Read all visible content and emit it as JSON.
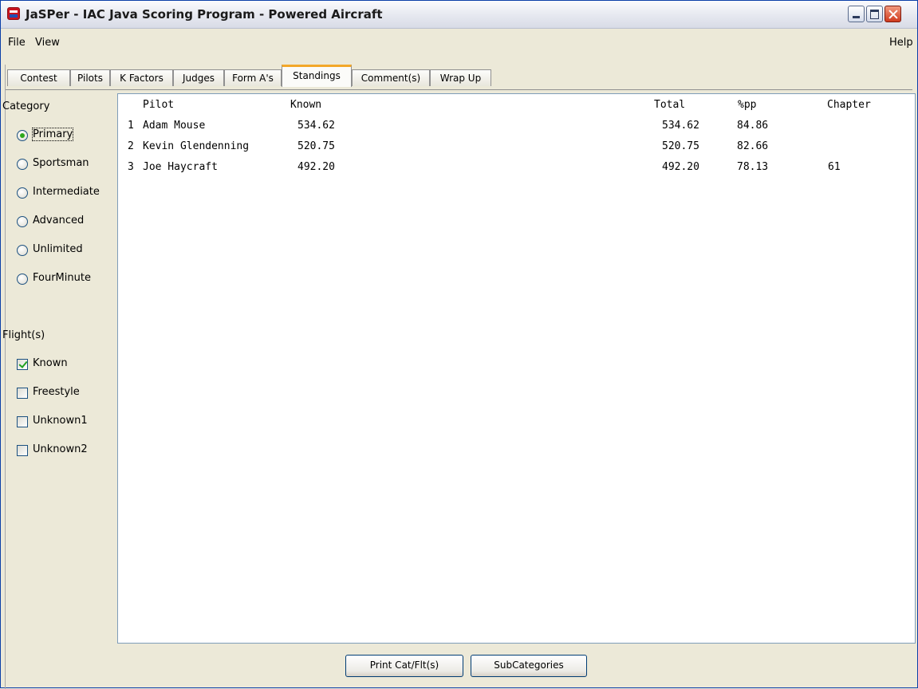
{
  "window": {
    "title": "JaSPer - IAC Java Scoring Program - Powered Aircraft",
    "app_icon": "iac-logo-icon"
  },
  "menu": {
    "file": "File",
    "view": "View",
    "help": "Help"
  },
  "tabs": [
    {
      "label": "Contest",
      "active": false
    },
    {
      "label": "Pilots",
      "active": false
    },
    {
      "label": "K Factors",
      "active": false
    },
    {
      "label": "Judges",
      "active": false
    },
    {
      "label": "Form A's",
      "active": false
    },
    {
      "label": "Standings",
      "active": true
    },
    {
      "label": "Comment(s)",
      "active": false
    },
    {
      "label": "Wrap Up",
      "active": false
    }
  ],
  "category": {
    "label": "Category",
    "options": [
      {
        "label": "Primary",
        "checked": true
      },
      {
        "label": "Sportsman",
        "checked": false
      },
      {
        "label": "Intermediate",
        "checked": false
      },
      {
        "label": "Advanced",
        "checked": false
      },
      {
        "label": "Unlimited",
        "checked": false
      },
      {
        "label": "FourMinute",
        "checked": false
      }
    ]
  },
  "flights": {
    "label": "Flight(s)",
    "options": [
      {
        "label": "Known",
        "checked": true
      },
      {
        "label": "Freestyle",
        "checked": false
      },
      {
        "label": "Unknown1",
        "checked": false
      },
      {
        "label": "Unknown2",
        "checked": false
      }
    ]
  },
  "standings": {
    "headers": {
      "pilot": "Pilot",
      "known": "Known",
      "total": "Total",
      "pp": "%pp",
      "chapter": "Chapter"
    },
    "rows": [
      {
        "rank": "1",
        "pilot": "Adam Mouse",
        "known": "534.62",
        "total": "534.62",
        "pp": "84.86",
        "chapter": ""
      },
      {
        "rank": "2",
        "pilot": "Kevin Glendenning",
        "known": "520.75",
        "total": "520.75",
        "pp": "82.66",
        "chapter": ""
      },
      {
        "rank": "3",
        "pilot": "Joe Haycraft",
        "known": "492.20",
        "total": "492.20",
        "pp": "78.13",
        "chapter": "61"
      }
    ]
  },
  "buttons": {
    "print": "Print Cat/Flt(s)",
    "subcategories": "SubCategories"
  }
}
